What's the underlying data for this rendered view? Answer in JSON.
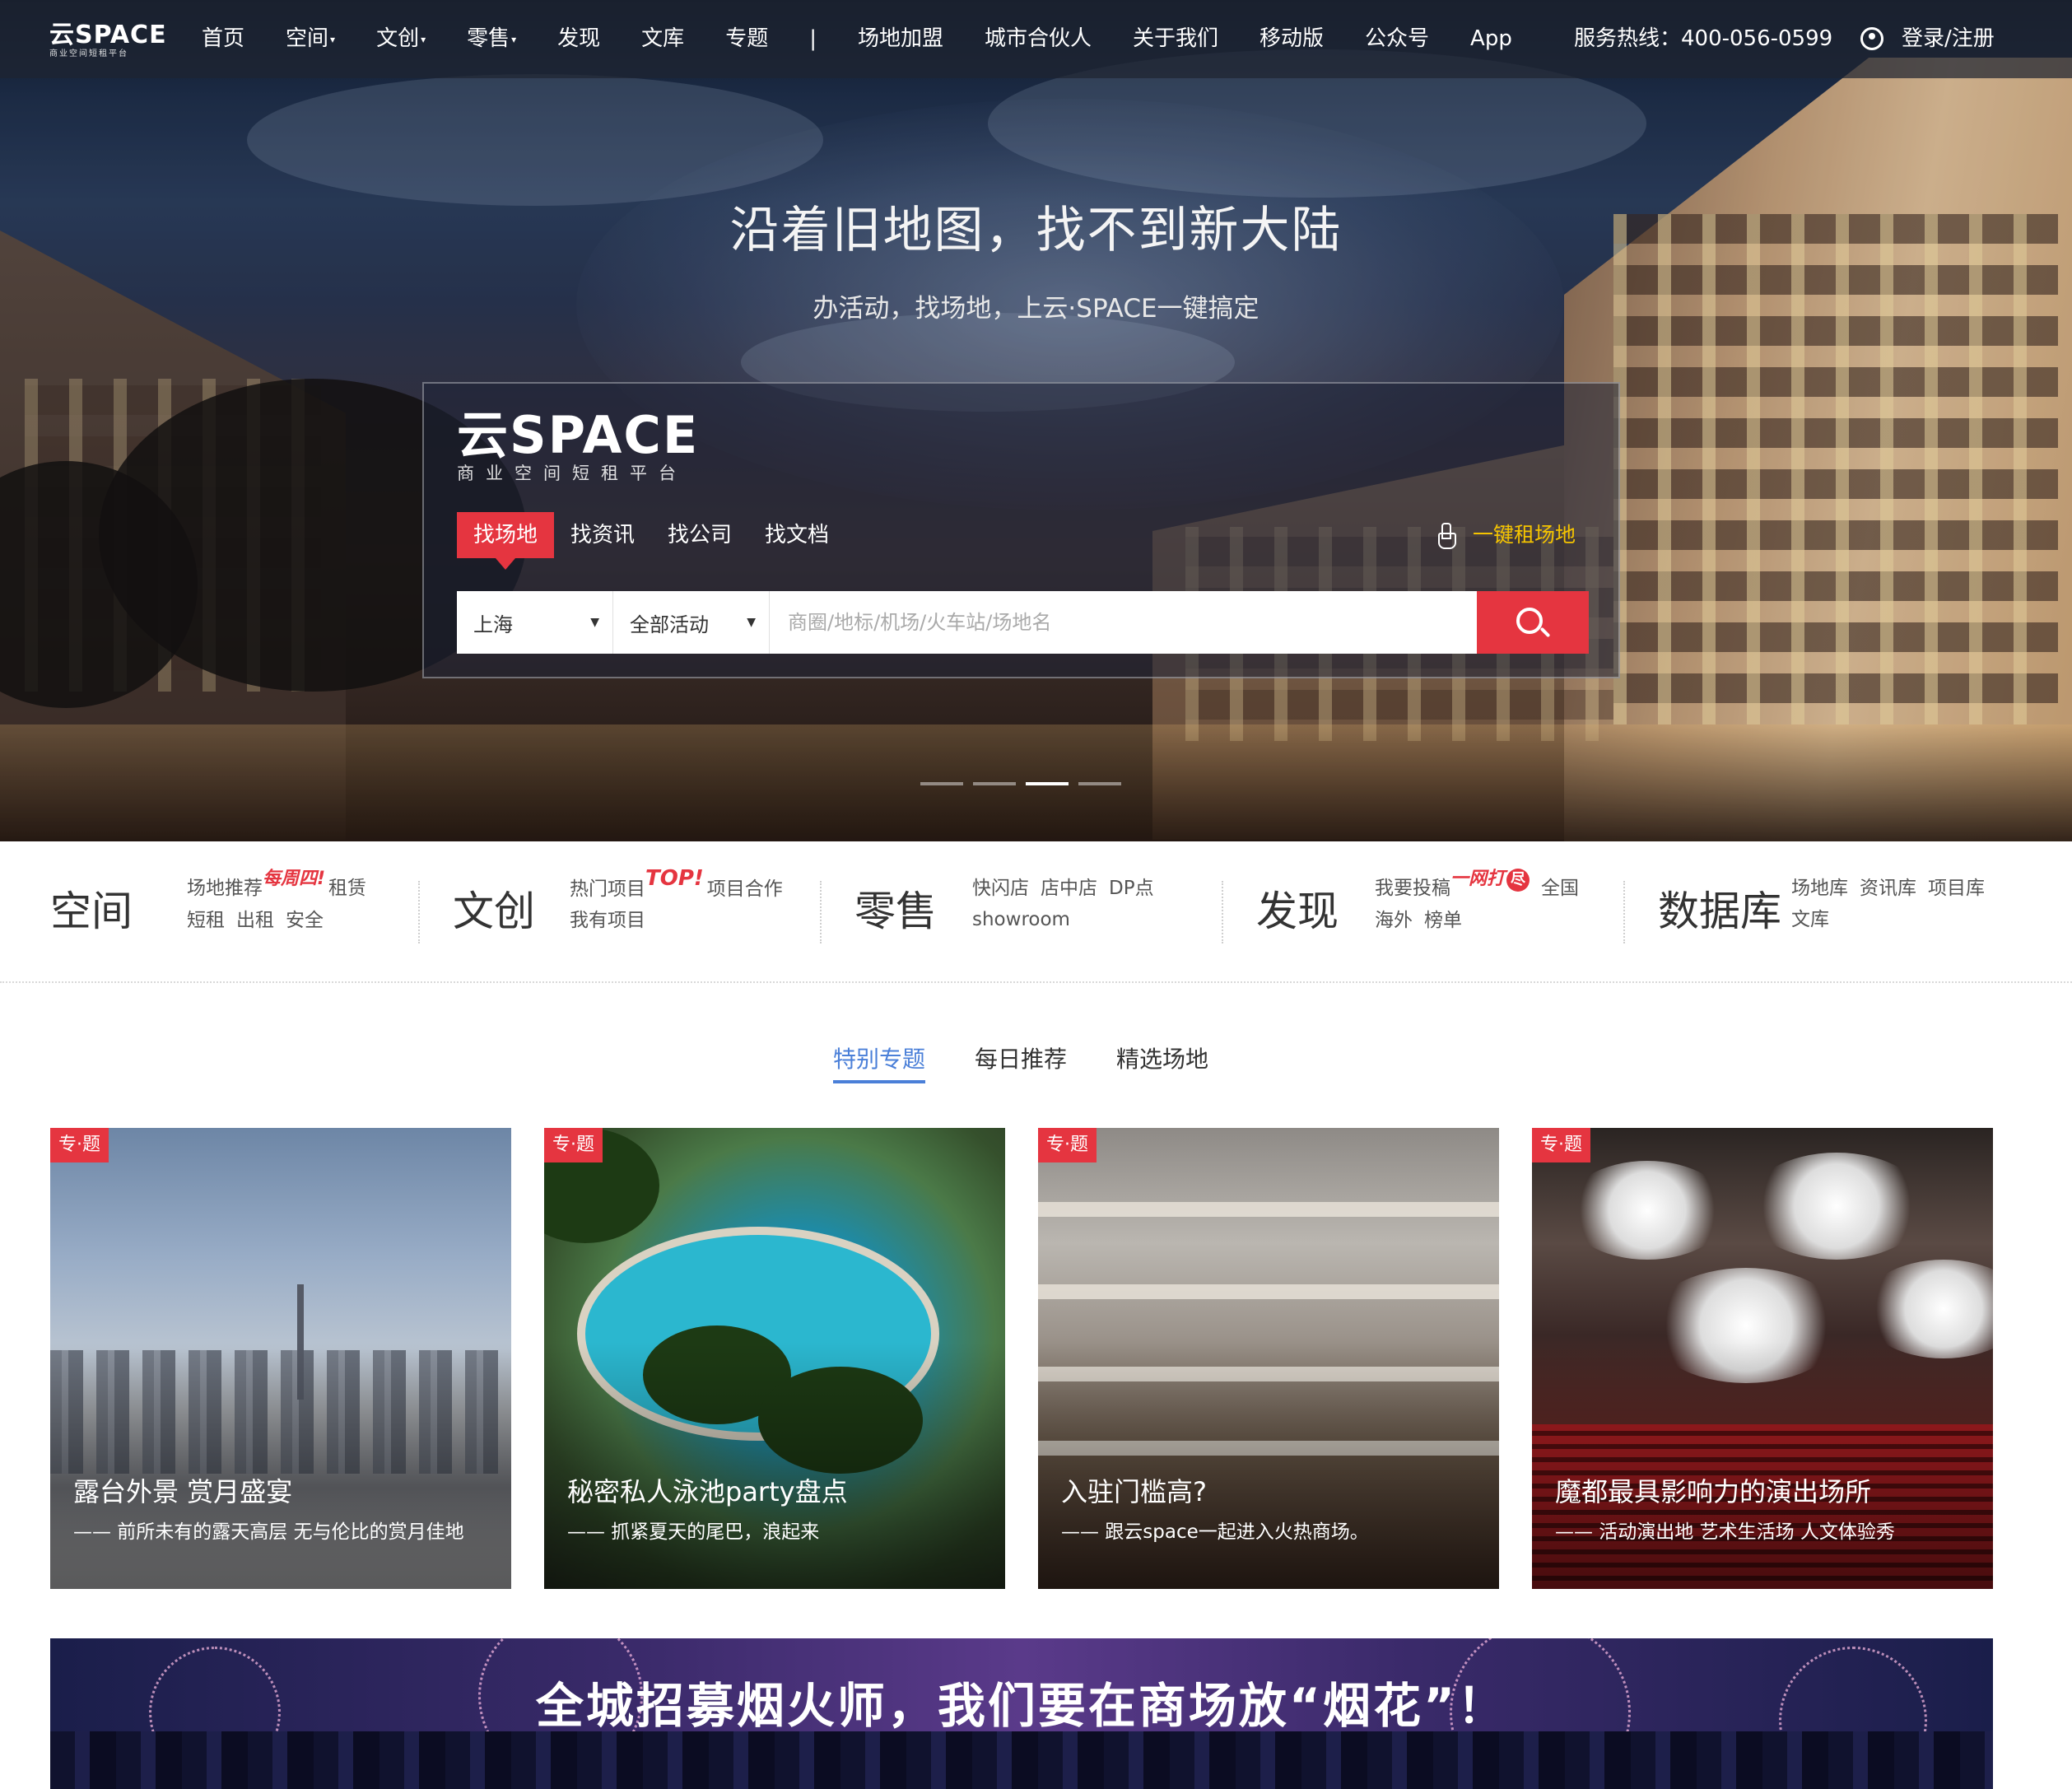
{
  "nav": {
    "logo": "云SPACE",
    "logo_sub": "商业空间短租平台",
    "items": [
      {
        "label": "首页",
        "caret": false
      },
      {
        "label": "空间",
        "caret": true
      },
      {
        "label": "文创",
        "caret": true
      },
      {
        "label": "零售",
        "caret": true
      },
      {
        "label": "发现",
        "caret": false
      },
      {
        "label": "文库",
        "caret": false
      },
      {
        "label": "专题",
        "caret": false
      },
      {
        "label": "|",
        "caret": false
      },
      {
        "label": "场地加盟",
        "caret": false
      },
      {
        "label": "城市合伙人",
        "caret": false
      },
      {
        "label": "关于我们",
        "caret": false
      },
      {
        "label": "移动版",
        "caret": false
      },
      {
        "label": "公众号",
        "caret": false
      },
      {
        "label": "App",
        "caret": false
      }
    ],
    "caret_glyph": "▾",
    "hotline": "服务热线：400-056-0599",
    "login": "登录/注册"
  },
  "hero": {
    "slogan": "沿着旧地图，找不到新大陆",
    "subtitle": "办活动，找场地，上云·SPACE一键搞定"
  },
  "search": {
    "logo": "云SPACE",
    "logo_sub": "商业空间短租平台",
    "tabs": [
      "找场地",
      "找资讯",
      "找公司",
      "找文档"
    ],
    "quick_rent": "一键租场地",
    "city": "上海",
    "activity": "全部活动",
    "dropdown_glyph": "▼",
    "placeholder": "商圈/地标/机场/火车站/场地名"
  },
  "slider": {
    "count": 4,
    "active_index": 2
  },
  "categories": [
    {
      "title": "空间",
      "rows": [
        [
          "场地推荐",
          "每周四!",
          "租赁"
        ],
        [
          "短租",
          "出租",
          "安全"
        ]
      ]
    },
    {
      "title": "文创",
      "rows": [
        [
          "热门项目",
          "TOP!",
          "项目合作"
        ],
        [
          "我有项目"
        ]
      ]
    },
    {
      "title": "零售",
      "rows": [
        [
          "快闪店",
          "店中店",
          "DP点"
        ],
        [
          "showroom"
        ]
      ]
    },
    {
      "title": "发现",
      "rows": [
        [
          "我要投稿",
          "一网打尽",
          "全国"
        ],
        [
          "海外",
          "榜单"
        ]
      ]
    },
    {
      "title": "数据库",
      "rows": [
        [
          "场地库",
          "资讯库",
          "项目库"
        ],
        [
          "文库"
        ]
      ]
    }
  ],
  "category_badges": {
    "space": "每周四!",
    "culture": "TOP!",
    "discover_text": "一网打",
    "discover_circle": "尽"
  },
  "section_tabs": [
    "特别专题",
    "每日推荐",
    "精选场地"
  ],
  "cards": [
    {
      "tag": "专·题",
      "title": "露台外景 赏月盛宴",
      "desc": "—— 前所未有的露天高层 无与伦比的赏月佳地"
    },
    {
      "tag": "专·题",
      "title": "秘密私人泳池party盘点",
      "desc": "—— 抓紧夏天的尾巴，浪起来"
    },
    {
      "tag": "专·题",
      "title": "入驻门槛高?",
      "desc": "—— 跟云space一起进入火热商场。"
    },
    {
      "tag": "专·题",
      "title": "魔都最具影响力的演出场所",
      "desc": "—— 活动演出地 艺术生活场 人文体验秀"
    }
  ],
  "banner": {
    "text": "全城招募烟火师，我们要在商场放“烟花”！"
  },
  "colors": {
    "accent_red": "#e53540",
    "tab_blue": "#4a7fd8",
    "quick_rent_yellow": "#f5c400"
  }
}
